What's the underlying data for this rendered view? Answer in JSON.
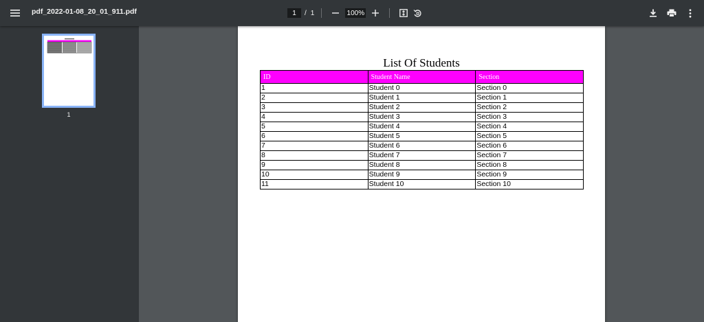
{
  "toolbar": {
    "file_name": "pdf_2022-01-08_20_01_911.pdf",
    "current_page": "1",
    "page_separator": "/",
    "total_pages": "1",
    "zoom": "100%"
  },
  "sidebar": {
    "thumbnails": [
      {
        "label": "1"
      }
    ]
  },
  "document": {
    "title": "List Of Students",
    "header_color": "#ff00ff",
    "columns": [
      "ID",
      "Student Name",
      "Section"
    ],
    "rows": [
      [
        "1",
        "Student 0",
        "Section 0"
      ],
      [
        "2",
        "Student 1",
        "Section 1"
      ],
      [
        "3",
        "Student 2",
        "Section 2"
      ],
      [
        "4",
        "Student 3",
        "Section 3"
      ],
      [
        "5",
        "Student 4",
        "Section 4"
      ],
      [
        "6",
        "Student 5",
        "Section 5"
      ],
      [
        "7",
        "Student 6",
        "Section 6"
      ],
      [
        "8",
        "Student 7",
        "Section 7"
      ],
      [
        "9",
        "Student 8",
        "Section 8"
      ],
      [
        "10",
        "Student 9",
        "Section 9"
      ],
      [
        "11",
        "Student 10",
        "Section 10"
      ]
    ]
  },
  "icons": {
    "menu": "menu-icon",
    "zoom_out": "minus-icon",
    "zoom_in": "plus-icon",
    "fit": "fit-to-page-icon",
    "rotate": "rotate-counterclockwise-icon",
    "download": "download-icon",
    "print": "print-icon",
    "more": "more-vertical-icon"
  }
}
